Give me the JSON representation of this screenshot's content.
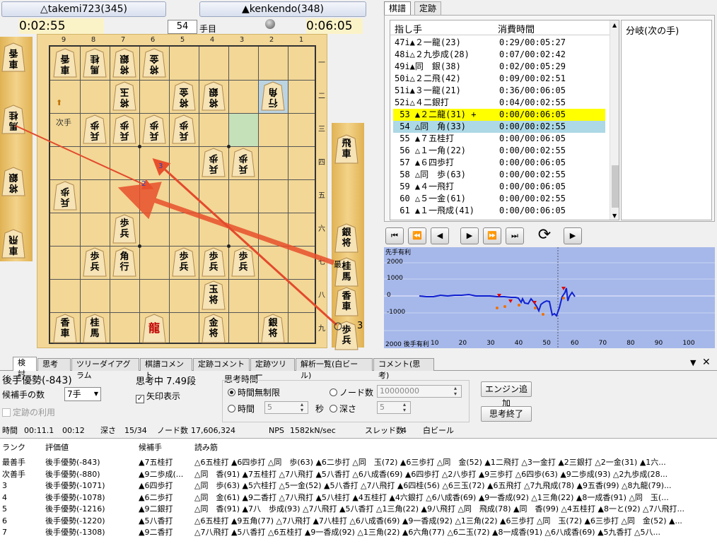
{
  "players": {
    "sente": "△takemi723(345)",
    "gote": "▲kenkendo(348)"
  },
  "clocks": {
    "left": "0:02:55",
    "right": "0:06:05"
  },
  "move_number": "54",
  "move_suffix": "手目",
  "files": [
    "9",
    "8",
    "7",
    "6",
    "5",
    "4",
    "3",
    "2",
    "1"
  ],
  "ranks": [
    "一",
    "二",
    "三",
    "四",
    "五",
    "六",
    "七",
    "八",
    "九"
  ],
  "hand_counts": {
    "sente_extra": "3"
  },
  "arrow_labels": {
    "a": "2",
    "b": "3"
  },
  "next_move_label": "次手",
  "best_move_label": "最",
  "left_hand": [
    {
      "k": "gote",
      "ch": "香車"
    },
    {
      "k": "gote",
      "ch": "桂馬"
    },
    {
      "k": "gote",
      "ch": "銀将"
    },
    {
      "k": "gote",
      "ch": "飛車"
    }
  ],
  "right_hand": [
    {
      "ch": "飛車"
    },
    {
      "ch": "銀将"
    },
    {
      "ch": "桂馬"
    },
    {
      "ch": "香車"
    },
    {
      "ch": "歩兵"
    }
  ],
  "pieces": [
    {
      "f": 9,
      "r": 1,
      "ch": "香車",
      "g": 1
    },
    {
      "f": 8,
      "r": 1,
      "ch": "桂馬",
      "g": 1
    },
    {
      "f": 7,
      "r": 1,
      "ch": "銀将",
      "g": 1
    },
    {
      "f": 6,
      "r": 1,
      "ch": "金将",
      "g": 1
    },
    {
      "f": 7,
      "r": 2,
      "ch": "玉将",
      "g": 1
    },
    {
      "f": 5,
      "r": 2,
      "ch": "金将",
      "g": 1
    },
    {
      "f": 4,
      "r": 2,
      "ch": "銀将",
      "g": 1
    },
    {
      "f": 2,
      "r": 2,
      "ch": "角行",
      "g": 1
    },
    {
      "f": 8,
      "r": 3,
      "ch": "歩兵",
      "g": 1
    },
    {
      "f": 7,
      "r": 3,
      "ch": "歩兵",
      "g": 1
    },
    {
      "f": 6,
      "r": 3,
      "ch": "歩兵",
      "g": 1
    },
    {
      "f": 5,
      "r": 3,
      "ch": "歩兵",
      "g": 1
    },
    {
      "f": 4,
      "r": 4,
      "ch": "歩兵",
      "g": 1
    },
    {
      "f": 3,
      "r": 4,
      "ch": "歩兵",
      "g": 1
    },
    {
      "f": 9,
      "r": 5,
      "ch": "歩兵",
      "g": 1
    },
    {
      "f": 7,
      "r": 6,
      "ch": "歩兵",
      "g": 0
    },
    {
      "f": 8,
      "r": 7,
      "ch": "歩兵",
      "g": 0
    },
    {
      "f": 7,
      "r": 7,
      "ch": "角行",
      "g": 0
    },
    {
      "f": 5,
      "r": 7,
      "ch": "歩兵",
      "g": 0
    },
    {
      "f": 4,
      "r": 7,
      "ch": "歩兵",
      "g": 0
    },
    {
      "f": 3,
      "r": 7,
      "ch": "歩兵",
      "g": 0
    },
    {
      "f": 4,
      "r": 8,
      "ch": "玉将",
      "g": 0
    },
    {
      "f": 9,
      "r": 9,
      "ch": "香車",
      "g": 0
    },
    {
      "f": 8,
      "r": 9,
      "ch": "桂馬",
      "g": 0
    },
    {
      "f": 6,
      "r": 9,
      "ch": "龍",
      "g": 0,
      "red": 1
    },
    {
      "f": 4,
      "r": 9,
      "ch": "金将",
      "g": 0
    },
    {
      "f": 2,
      "r": 9,
      "ch": "銀将",
      "g": 0
    }
  ],
  "tabs_top": [
    "棋譜",
    "定跡"
  ],
  "kifu_headers": {
    "move": "指し手",
    "time": "消費時間"
  },
  "branch_header": "分岐(次の手)",
  "kifu": [
    {
      "n": "47i▲２一龍(23)",
      "t": "0:29/00:05:27"
    },
    {
      "n": "48i△２九歩成(28)",
      "t": "0:07/00:02:42"
    },
    {
      "n": "49i▲同　銀(38)",
      "t": "0:02/00:05:29"
    },
    {
      "n": "50i△２二飛(42)",
      "t": "0:09/00:02:51"
    },
    {
      "n": "51i▲３一龍(21)",
      "t": "0:36/00:06:05"
    },
    {
      "n": "52i△４二銀打",
      "t": "0:04/00:02:55"
    },
    {
      "n": " 53 ▲２二龍(31) +",
      "t": "0:00/00:06:05",
      "hl": "yellow"
    },
    {
      "n": " 54 △同　角(33)",
      "t": "0:00/00:02:55",
      "hl": "blue"
    },
    {
      "n": " 55 ▲７五桂打",
      "t": "0:00/00:06:05"
    },
    {
      "n": " 56 △１一角(22)",
      "t": "0:00/00:02:55"
    },
    {
      "n": " 57 ▲６四歩打",
      "t": "0:00/00:06:05"
    },
    {
      "n": " 58 △同　歩(63)",
      "t": "0:00/00:02:55"
    },
    {
      "n": " 59 ▲４一飛打",
      "t": "0:00/00:06:05"
    },
    {
      "n": " 60 △５一金(61)",
      "t": "0:00/00:02:55"
    },
    {
      "n": " 61 ▲１一飛成(41)",
      "t": "0:00/00:06:05"
    }
  ],
  "graph": {
    "title": "先手有利",
    "bottom_label": "2000 後手有利",
    "y_ticks": [
      "2000",
      "1000",
      "0",
      "-1000"
    ],
    "x_ticks": [
      "10",
      "20",
      "30",
      "40",
      "50",
      "60",
      "70",
      "80",
      "90",
      "100"
    ],
    "bg": "#a6b8ea",
    "line_color": "#1020d0"
  },
  "bottom_tabs": [
    "検討",
    "思考",
    "ツリーダイアグラム",
    "棋譜コメント",
    "定跡コメント",
    "定跡ツリー",
    "解析一覧(白ビール)",
    "コメント(思考)"
  ],
  "analysis": {
    "evaluation": "後手優勢(-843)",
    "thinking": "思考中 7.49段",
    "candidates_label": "候補手の数",
    "candidates_value": "7手",
    "arrow_label": "矢印表示",
    "joseki_label": "定跡の利用",
    "think_time_label": "思考時間",
    "unlimited": "時間無制限",
    "time": "時間",
    "time_val": "5",
    "seconds": "秒",
    "nodes": "ノード数",
    "nodes_val": "10000000",
    "depth": "深さ",
    "depth_val": "5",
    "add_engine": "エンジン追加",
    "stop": "思考終了"
  },
  "status": {
    "time_label": "時間",
    "time_val": "00:11.1",
    "time_val2": "00:12",
    "depth_label": "深さ",
    "depth_val": "15/34",
    "nodes_label": "ノード数",
    "nodes_val": "17,606,324",
    "nps_label": "NPS",
    "nps_val": "1582kN/sec",
    "thread_label": "スレッド数",
    "thread_val": "4",
    "engine": "白ビール"
  },
  "pv_headers": {
    "rank": "ランク",
    "eval": "評価値",
    "move": "候補手",
    "pv": "読み筋"
  },
  "pv": [
    {
      "rank": "最善手",
      "eval": "後手優勢(-843)",
      "move": "▲7五桂打",
      "pv": "△6五桂打 ▲6四歩打 △同　歩(63) ▲6二歩打 △同　玉(72) ▲6三歩打 △同　金(52) ▲1二飛打 △3一金打 ▲2三銀打 △2一金(31) ▲1六..."
    },
    {
      "rank": "次善手",
      "eval": "後手優勢(-880)",
      "move": "▲9二歩成(...",
      "pv": "△同　香(91) ▲7五桂打 △7八飛打 ▲5八香打 △6八成香(69) ▲6四歩打 △2八歩打 ▲9三歩打 △6四歩(63) ▲9二歩成(93) △2九歩成(28..."
    },
    {
      "rank": "3",
      "eval": "後手優勢(-1071)",
      "move": "▲6四歩打",
      "pv": "△同　歩(63) ▲5六桂打 △5一金(52) ▲5八香打 △7八飛打 ▲6四桂(56) △6三玉(72) ▲6五飛打 △7九飛成(78) ▲9五香(99) △8九龍(79)..."
    },
    {
      "rank": "4",
      "eval": "後手優勢(-1078)",
      "move": "▲6二歩打",
      "pv": "△同　金(61) ▲9二香打 △7八飛打 ▲5八桂打 ▲4五桂打 ▲4六銀打 △6八成香(69) ▲9一香成(92) △1三角(22) ▲8一成香(91) △同　玉(..."
    },
    {
      "rank": "5",
      "eval": "後手優勢(-1216)",
      "move": "▲9二銀打",
      "pv": "△同　香(91) ▲7八　歩成(93) △7八飛打 ▲5八香打 △1三角(22) ▲9八飛打 △同　飛成(78) ▲同　香(99) △4五桂打 ▲8一と(92) △7八飛打..."
    },
    {
      "rank": "6",
      "eval": "後手優勢(-1220)",
      "move": "▲5八香打",
      "pv": "△6五桂打 ▲9五角(77) △7八飛打 ▲7八桂打 △6八成香(69) ▲9一香成(92) △1三角(22) ▲6三歩打 △同　玉(72) ▲6三歩打 △同　金(52) ▲..."
    },
    {
      "rank": "7",
      "eval": "後手優勢(-1308)",
      "move": "▲9二香打",
      "pv": "△7八飛打 ▲5八香打 △6五桂打 ▲9一香成(92) △1三角(22) ▲6六角(77) △6二玉(72) ▲8一成香(91) △6八成香(69) ▲5九香打 △5八..."
    }
  ]
}
